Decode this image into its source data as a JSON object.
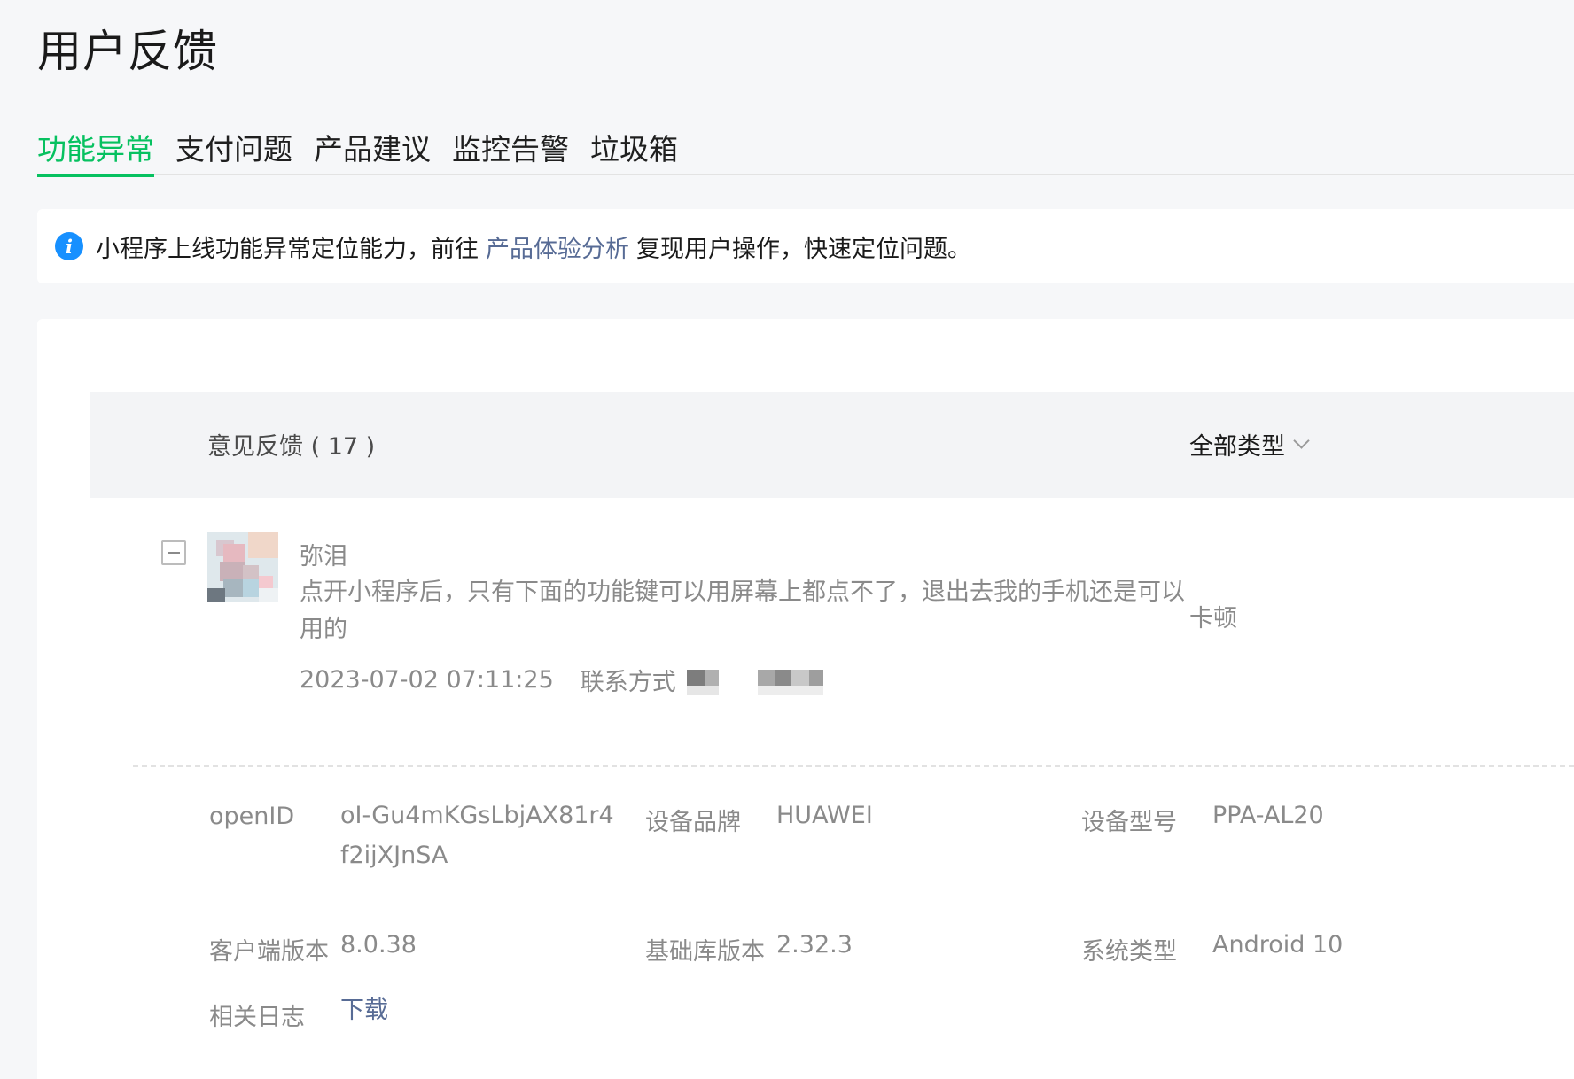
{
  "page": {
    "title": "用户反馈"
  },
  "tabs": [
    {
      "label": "功能异常",
      "active": true
    },
    {
      "label": "支付问题",
      "active": false
    },
    {
      "label": "产品建议",
      "active": false
    },
    {
      "label": "监控告警",
      "active": false
    },
    {
      "label": "垃圾箱",
      "active": false
    }
  ],
  "notice": {
    "text_before": "小程序上线功能异常定位能力，前往",
    "link": "产品体验分析",
    "text_after": "复现用户操作，快速定位问题。"
  },
  "list": {
    "title": "意见反馈 ( 17 )",
    "filter": "全部类型"
  },
  "feedback": {
    "user_name": "弥泪",
    "content": "点开小程序后，只有下面的功能键可以用屏幕上都点不了，退出去我的手机还是可以用的",
    "time": "2023-07-02 07:11:25",
    "contact_label": "联系方式",
    "category": "卡顿",
    "details": {
      "openid_label": "openID",
      "openid": "oI-Gu4mKGsLbjAX81r4f2ijXJnSA",
      "brand_label": "设备品牌",
      "brand": "HUAWEI",
      "model_label": "设备型号",
      "model": "PPA-AL20",
      "client_label": "客户端版本",
      "client": "8.0.38",
      "lib_label": "基础库版本",
      "lib": "2.32.3",
      "os_label": "系统类型",
      "os": "Android 10",
      "log_label": "相关日志",
      "log_link": "下载"
    }
  },
  "colors": {
    "accent": "#07c160",
    "link": "#576b95",
    "info": "#1790ff"
  }
}
